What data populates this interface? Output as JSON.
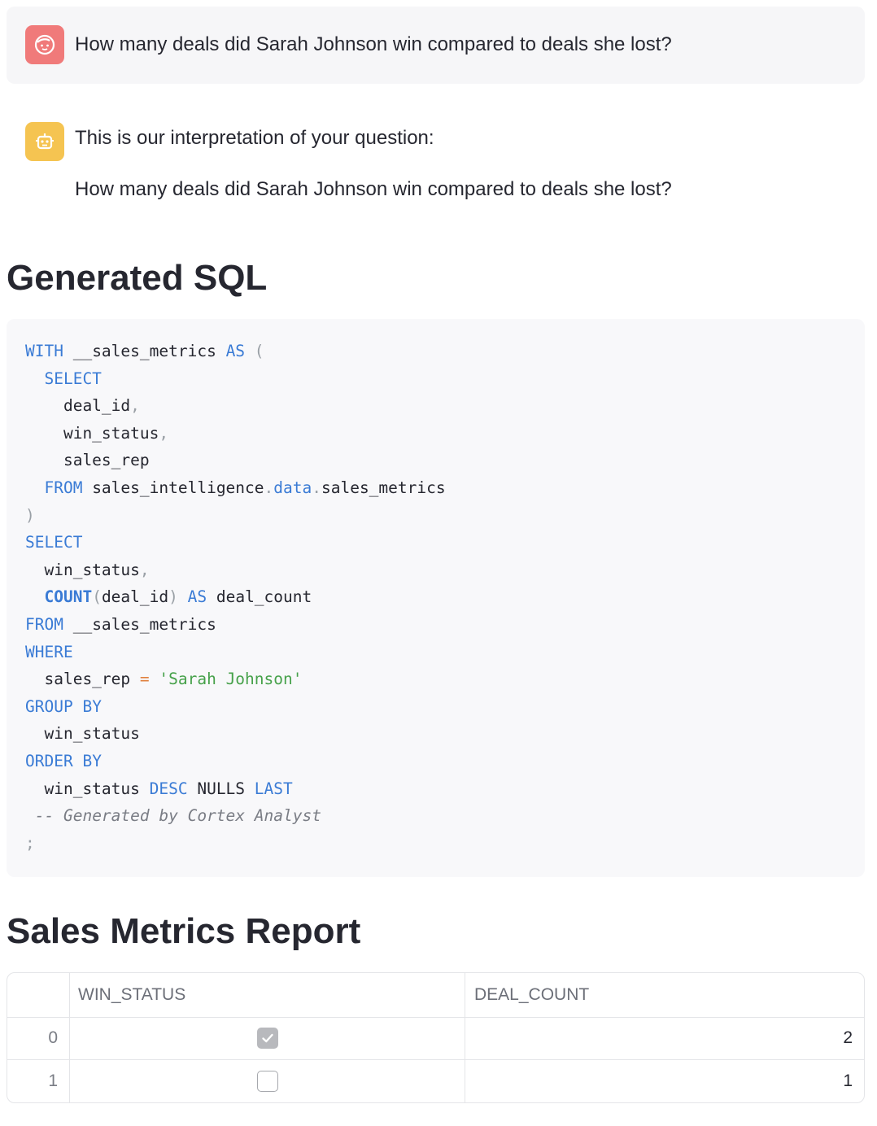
{
  "user_message": {
    "avatar_icon": "face-icon",
    "avatar_color": "#f07a7a",
    "text": "How many deals did Sarah Johnson win compared to deals she lost?"
  },
  "assistant_message": {
    "avatar_icon": "robot-icon",
    "avatar_color": "#f5c451",
    "intro": "This is our interpretation of your question:",
    "interpretation": "How many deals did Sarah Johnson win compared to deals she lost?"
  },
  "sql_section": {
    "title": "Generated SQL",
    "lines": [
      "WITH __sales_metrics AS (",
      "  SELECT",
      "    deal_id,",
      "    win_status,",
      "    sales_rep",
      "  FROM sales_intelligence.data.sales_metrics",
      ")",
      "SELECT",
      "  win_status,",
      "  COUNT(deal_id) AS deal_count",
      "FROM __sales_metrics",
      "WHERE",
      "  sales_rep = 'Sarah Johnson'",
      "GROUP BY",
      "  win_status",
      "ORDER BY",
      "  win_status DESC NULLS LAST",
      " -- Generated by Cortex Analyst",
      ";"
    ]
  },
  "report": {
    "title": "Sales Metrics Report",
    "columns": [
      "WIN_STATUS",
      "DEAL_COUNT"
    ],
    "rows": [
      {
        "index": "0",
        "win_status": true,
        "deal_count": "2"
      },
      {
        "index": "1",
        "win_status": false,
        "deal_count": "1"
      }
    ]
  }
}
